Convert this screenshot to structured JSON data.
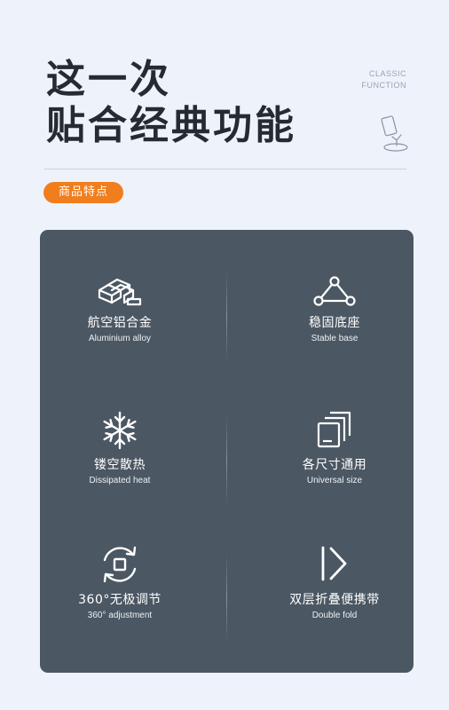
{
  "header": {
    "title_line1": "这一次",
    "title_line2": "贴合经典功能",
    "subtitle_en_line1": "CLASSIC",
    "subtitle_en_line2": "FUNCTION"
  },
  "badge": {
    "label": "商品特点"
  },
  "colors": {
    "accent": "#f17e1d",
    "panel": "#4b5763",
    "background": "#eef3fb"
  },
  "features": [
    {
      "zh": "航空铝合金",
      "en": "Aluminium alloy",
      "icon": "aluminium-bars-icon"
    },
    {
      "zh": "稳固底座",
      "en": "Stable base",
      "icon": "triangle-nodes-icon"
    },
    {
      "zh": "镂空散热",
      "en": "Dissipated heat",
      "icon": "snowflake-icon"
    },
    {
      "zh": "各尺寸通用",
      "en": "Universal size",
      "icon": "stacked-squares-icon"
    },
    {
      "zh": "360°无极调节",
      "en": "360° adjustment",
      "icon": "rotate-icon"
    },
    {
      "zh": "双层折叠便携带",
      "en": "Double fold",
      "icon": "fold-icon"
    }
  ]
}
